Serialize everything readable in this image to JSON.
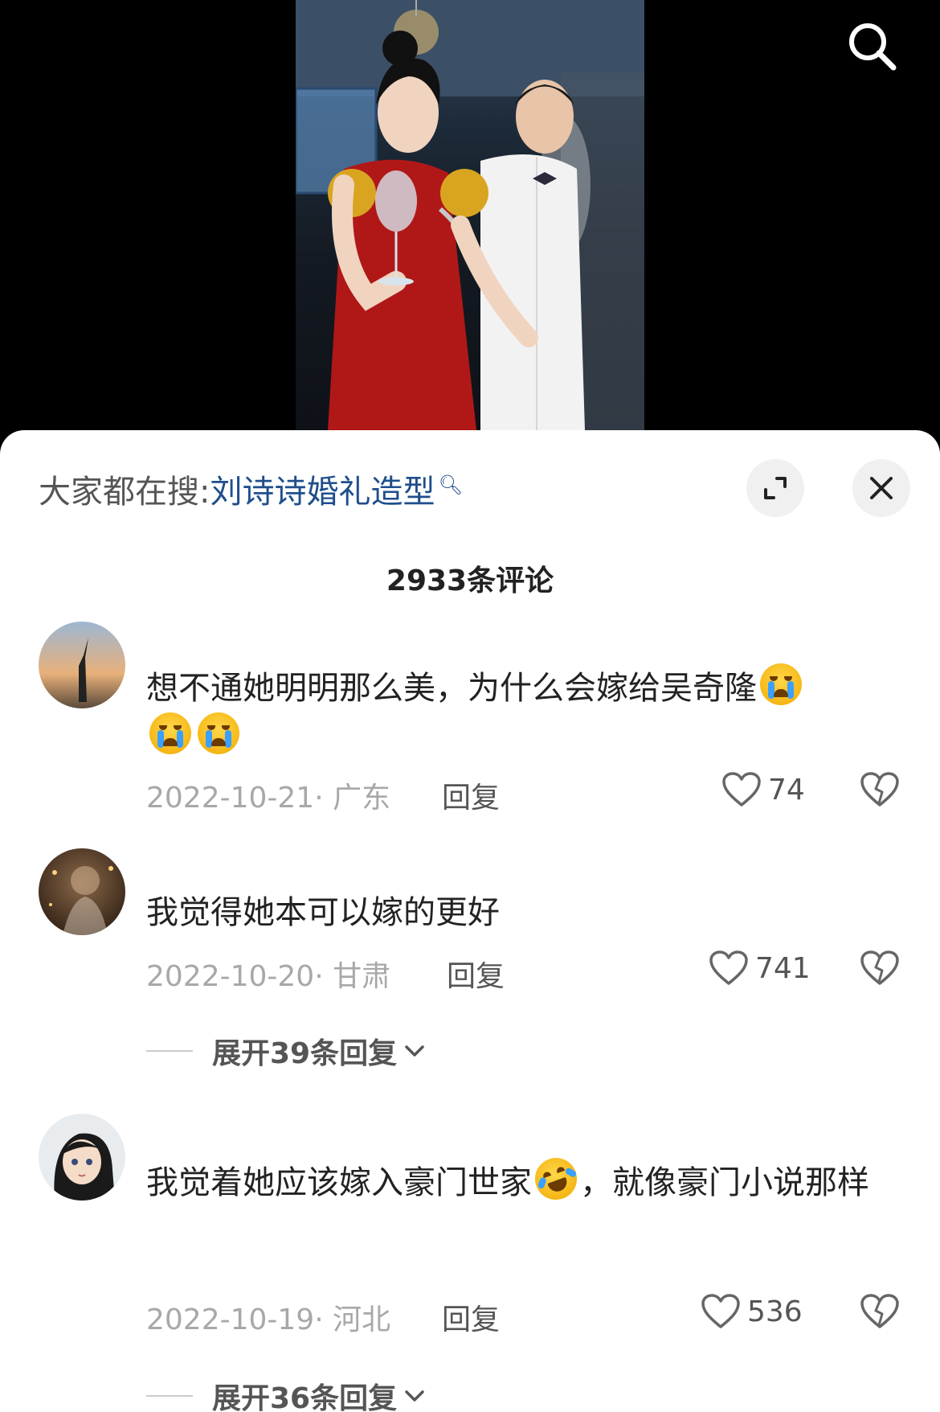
{
  "top": {
    "search_icon": "search-icon"
  },
  "sheet": {
    "hot_search_label": "大家都在搜:",
    "hot_search_keyword": "刘诗诗婚礼造型",
    "comment_count": "2933条评论"
  },
  "comments": [
    {
      "text": "想不通她明明那么美，为什么会嫁给吴奇隆",
      "emojis": [
        "loudly-crying-emoji",
        "loudly-crying-emoji",
        "loudly-crying-emoji"
      ],
      "date_location": "2022-10-21· 广东",
      "reply_label": "回复",
      "likes": "74"
    },
    {
      "text": "我觉得她本可以嫁的更好",
      "date_location": "2022-10-20· 甘肃",
      "reply_label": "回复",
      "likes": "741",
      "expand_label": "展开39条回复"
    },
    {
      "text_before_emoji": "我觉着她应该嫁入豪门世家",
      "emoji": "rolling-laughing-emoji",
      "text_after_emoji": "，就像豪门小说那样",
      "date_location": "2022-10-19· 河北",
      "reply_label": "回复",
      "likes": "536",
      "expand_label": "展开36条回复"
    }
  ]
}
